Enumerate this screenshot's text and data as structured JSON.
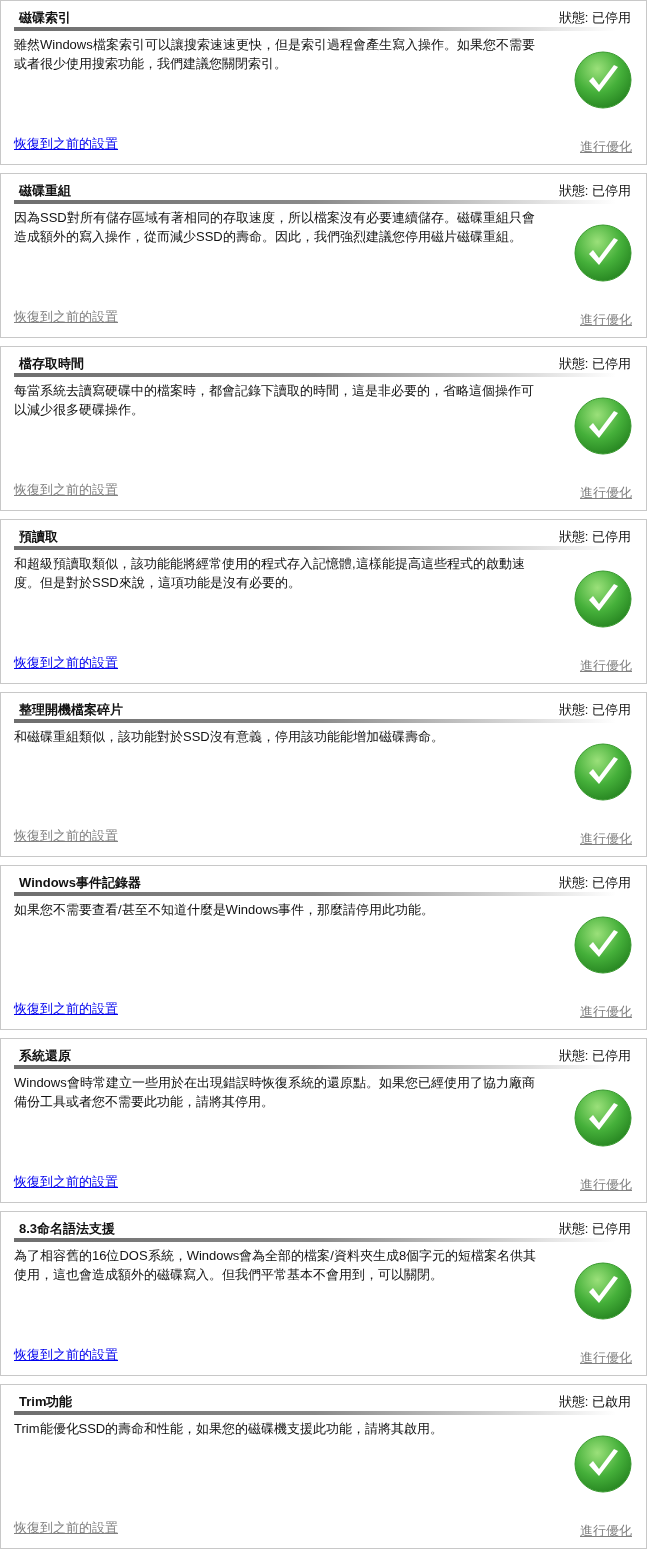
{
  "cards": [
    {
      "title": "磁碟索引",
      "status": "狀態: 已停用",
      "description": "雖然Windows檔案索引可以讓搜索速速更快，但是索引過程會產生寫入操作。如果您不需要或者很少使用搜索功能，我們建議您關閉索引。",
      "restore": {
        "label": "恢復到之前的設置",
        "disabled": false
      },
      "optimize": {
        "label": "進行優化",
        "disabled": true
      }
    },
    {
      "title": "磁碟重組",
      "status": "狀態: 已停用",
      "description": "因為SSD對所有儲存區域有著相同的存取速度，所以檔案沒有必要連續儲存。磁碟重組只會造成額外的寫入操作，從而減少SSD的壽命。因此，我們強烈建議您停用磁片磁碟重組。",
      "restore": {
        "label": "恢復到之前的設置",
        "disabled": true
      },
      "optimize": {
        "label": "進行優化",
        "disabled": true
      }
    },
    {
      "title": "檔存取時間",
      "status": "狀態: 已停用",
      "description": "每當系統去讀寫硬碟中的檔案時，都會記錄下讀取的時間，這是非必要的，省略這個操作可以減少很多硬碟操作。",
      "restore": {
        "label": "恢復到之前的設置",
        "disabled": true
      },
      "optimize": {
        "label": "進行優化",
        "disabled": true
      }
    },
    {
      "title": "預讀取",
      "status": "狀態: 已停用",
      "description": "和超級預讀取類似，該功能能將經常使用的程式存入記憶體,這樣能提高這些程式的啟動速度。但是對於SSD來說，這項功能是沒有必要的。",
      "restore": {
        "label": "恢復到之前的設置",
        "disabled": false
      },
      "optimize": {
        "label": "進行優化",
        "disabled": true
      }
    },
    {
      "title": "整理開機檔案碎片",
      "status": "狀態: 已停用",
      "description": "和磁碟重組類似，該功能對於SSD沒有意義，停用該功能能增加磁碟壽命。",
      "restore": {
        "label": "恢復到之前的設置",
        "disabled": true
      },
      "optimize": {
        "label": "進行優化",
        "disabled": true
      }
    },
    {
      "title": "Windows事件記錄器",
      "status": "狀態: 已停用",
      "description": "如果您不需要查看/甚至不知道什麼是Windows事件，那麼請停用此功能。",
      "restore": {
        "label": "恢復到之前的設置",
        "disabled": false
      },
      "optimize": {
        "label": "進行優化",
        "disabled": true
      }
    },
    {
      "title": "系統還原",
      "status": "狀態: 已停用",
      "description": "Windows會時常建立一些用於在出現錯誤時恢復系統的還原點。如果您已經使用了協力廠商備份工具或者您不需要此功能，請將其停用。",
      "restore": {
        "label": "恢復到之前的設置",
        "disabled": false
      },
      "optimize": {
        "label": "進行優化",
        "disabled": true
      }
    },
    {
      "title": "8.3命名語法支援",
      "status": "狀態: 已停用",
      "description": "為了相容舊的16位DOS系統，Windows會為全部的檔案/資料夾生成8個字元的短檔案名供其使用，這也會造成額外的磁碟寫入。但我們平常基本不會用到，可以關閉。",
      "restore": {
        "label": "恢復到之前的設置",
        "disabled": false
      },
      "optimize": {
        "label": "進行優化",
        "disabled": true
      }
    },
    {
      "title": "Trim功能",
      "status": "狀態: 已啟用",
      "description": "Trim能優化SSD的壽命和性能，如果您的磁碟機支援此功能，請將其啟用。",
      "restore": {
        "label": "恢復到之前的設置",
        "disabled": true
      },
      "optimize": {
        "label": "進行優化",
        "disabled": true
      }
    }
  ]
}
